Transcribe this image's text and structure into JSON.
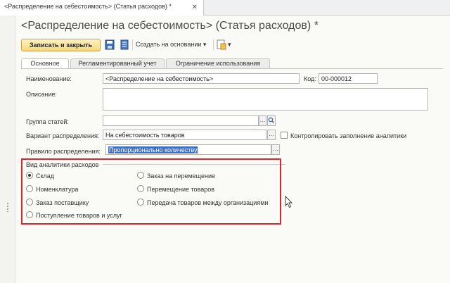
{
  "tab": {
    "title": "<Распределение на себестоимость> (Статья расходов) *",
    "close": "✕"
  },
  "header": {
    "title": "<Распределение на себестоимость> (Статья расходов) *"
  },
  "toolbar": {
    "save_close": "Записать и закрыть",
    "create_based": "Создать на основании",
    "create_arrow": "▾",
    "more_arrow": "▾"
  },
  "form_tabs": [
    "Основное",
    "Регламентированный учет",
    "Ограничение использования"
  ],
  "fields": {
    "name_label": "Наименование:",
    "name_value": "<Распределение на себестоимость>",
    "code_label": "Код:",
    "code_value": "00-000012",
    "description_label": "Описание:",
    "group_label": "Группа статей:",
    "variant_label": "Вариант распределения:",
    "variant_value": "На себестоимость товаров",
    "control_label": "Контролировать заполнение аналитики",
    "rule_label": "Правило распределения:",
    "rule_value": "Пропорционально количеству"
  },
  "analytics": {
    "title": "Вид аналитики расходов",
    "selected": "Склад",
    "options": [
      "Склад",
      "Номенклатура",
      "Заказ поставщику",
      "Поступление товаров и услуг",
      "Заказ на перемещение",
      "Перемещение товаров",
      "Передача товаров между организациями"
    ]
  },
  "colors": {
    "highlight": "#e0242a",
    "primary_button": "#f6d77a",
    "selection": "#3d6fc4"
  }
}
